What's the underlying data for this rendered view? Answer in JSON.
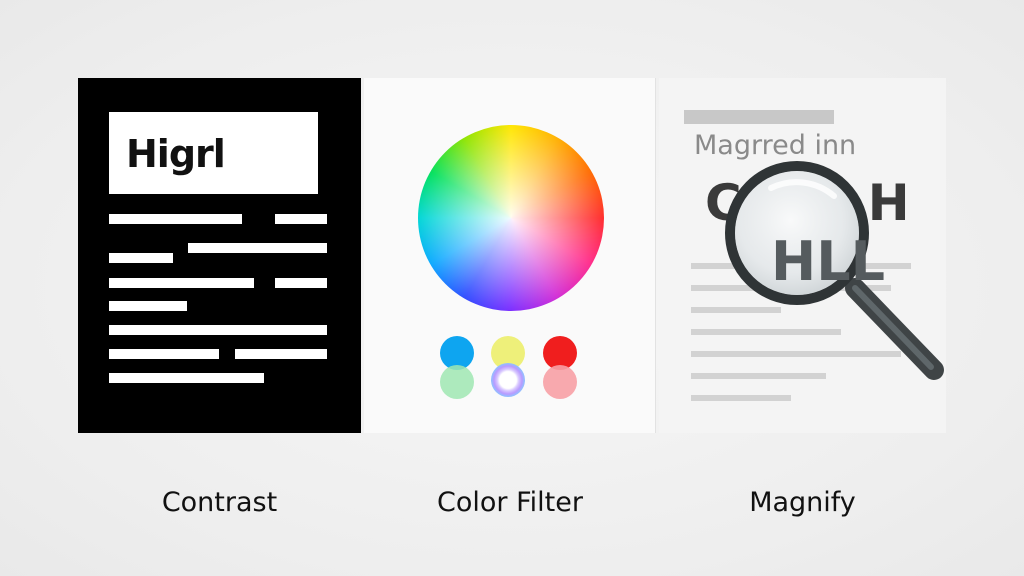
{
  "panels": {
    "contrast": {
      "label": "Contrast",
      "sample_text": "Higrl",
      "icon": "high-contrast-document-icon"
    },
    "color_filter": {
      "label": "Color Filter",
      "icon": "color-wheel-icon",
      "swatch_colors": [
        "#0ea5f0",
        "#eef07a",
        "#f01e1e",
        "#9fe6b2",
        "#b99bff",
        "#f7a0a5"
      ]
    },
    "magnify": {
      "label": "Magnify",
      "heading_text": "Magrred inn",
      "big_text_line1": "CLOS H",
      "big_text_line2": "HLL",
      "icon": "magnifying-glass-icon"
    }
  },
  "colors": {
    "contrast_bg": "#000000",
    "contrast_fg": "#ffffff",
    "magnifier_handle": "#3f4446"
  }
}
